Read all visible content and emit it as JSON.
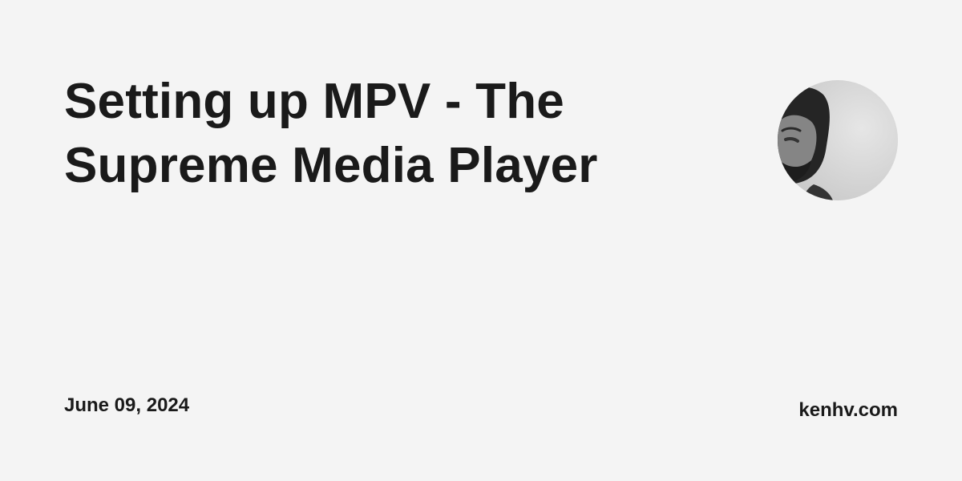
{
  "post": {
    "title": "Setting up MPV - The Supreme Media Player",
    "date": "June 09, 2024",
    "site": "kenhv.com"
  },
  "author": {
    "avatar_icon": "author-avatar-photo"
  },
  "colors": {
    "background": "#f4f4f4",
    "text": "#1a1a1a"
  }
}
